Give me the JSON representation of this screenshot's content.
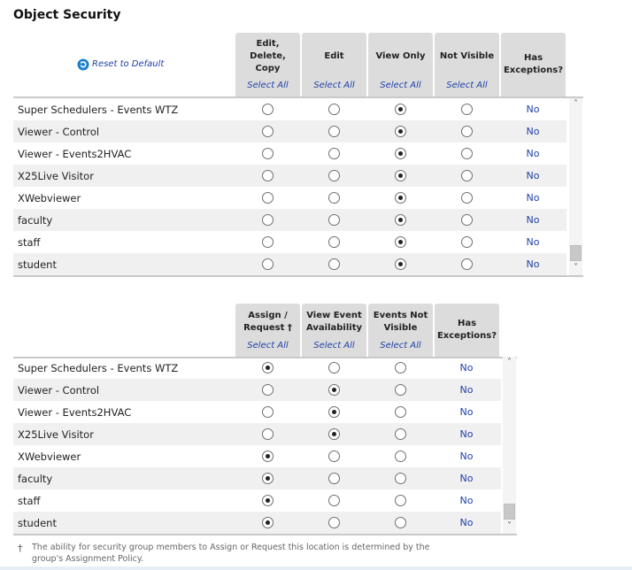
{
  "title": "Object Security",
  "reset": {
    "label": "Reset to Default",
    "icon": "reset-icon"
  },
  "select_all_label": "Select All",
  "exceptions_value": "No",
  "table1": {
    "columns": [
      {
        "label": "Edit, Delete, Copy",
        "lines": [
          "Edit,",
          "Delete,",
          "Copy"
        ],
        "select_all": true
      },
      {
        "label": "Edit",
        "lines": [
          "Edit"
        ],
        "select_all": true
      },
      {
        "label": "View Only",
        "lines": [
          "View Only"
        ],
        "select_all": true
      },
      {
        "label": "Not Visible",
        "lines": [
          "Not Visible"
        ],
        "select_all": true
      },
      {
        "label": "Has Exceptions?",
        "lines": [
          "Has",
          "Exceptions?"
        ],
        "select_all": false
      }
    ],
    "rows": [
      {
        "name": "Super Schedulers - Events WTZ",
        "selected": 2,
        "exceptions": "No"
      },
      {
        "name": "Viewer - Control",
        "selected": 2,
        "exceptions": "No"
      },
      {
        "name": "Viewer - Events2HVAC",
        "selected": 2,
        "exceptions": "No"
      },
      {
        "name": "X25Live Visitor",
        "selected": 2,
        "exceptions": "No"
      },
      {
        "name": "XWebviewer",
        "selected": 2,
        "exceptions": "No"
      },
      {
        "name": "faculty",
        "selected": 2,
        "exceptions": "No"
      },
      {
        "name": "staff",
        "selected": 2,
        "exceptions": "No"
      },
      {
        "name": "student",
        "selected": 2,
        "exceptions": "No"
      }
    ]
  },
  "table2": {
    "columns": [
      {
        "label": "Assign / Request †",
        "lines": [
          "Assign /",
          "Request †"
        ],
        "select_all": true
      },
      {
        "label": "View Event Availability",
        "lines": [
          "View Event",
          "Availability"
        ],
        "select_all": true
      },
      {
        "label": "Events Not Visible",
        "lines": [
          "Events Not",
          "Visible"
        ],
        "select_all": true
      },
      {
        "label": "Has Exceptions?",
        "lines": [
          "Has",
          "Exceptions?"
        ],
        "select_all": false
      }
    ],
    "rows": [
      {
        "name": "Super Schedulers - Events WTZ",
        "selected": 0,
        "exceptions": "No"
      },
      {
        "name": "Viewer - Control",
        "selected": 1,
        "exceptions": "No"
      },
      {
        "name": "Viewer - Events2HVAC",
        "selected": 1,
        "exceptions": "No"
      },
      {
        "name": "X25Live Visitor",
        "selected": 1,
        "exceptions": "No"
      },
      {
        "name": "XWebviewer",
        "selected": 0,
        "exceptions": "No"
      },
      {
        "name": "faculty",
        "selected": 0,
        "exceptions": "No"
      },
      {
        "name": "staff",
        "selected": 0,
        "exceptions": "No"
      },
      {
        "name": "student",
        "selected": 0,
        "exceptions": "No"
      }
    ]
  },
  "footnote": {
    "symbol": "†",
    "text": "The ability for security group members to Assign or Request this location is determined by the group's Assignment Policy."
  }
}
